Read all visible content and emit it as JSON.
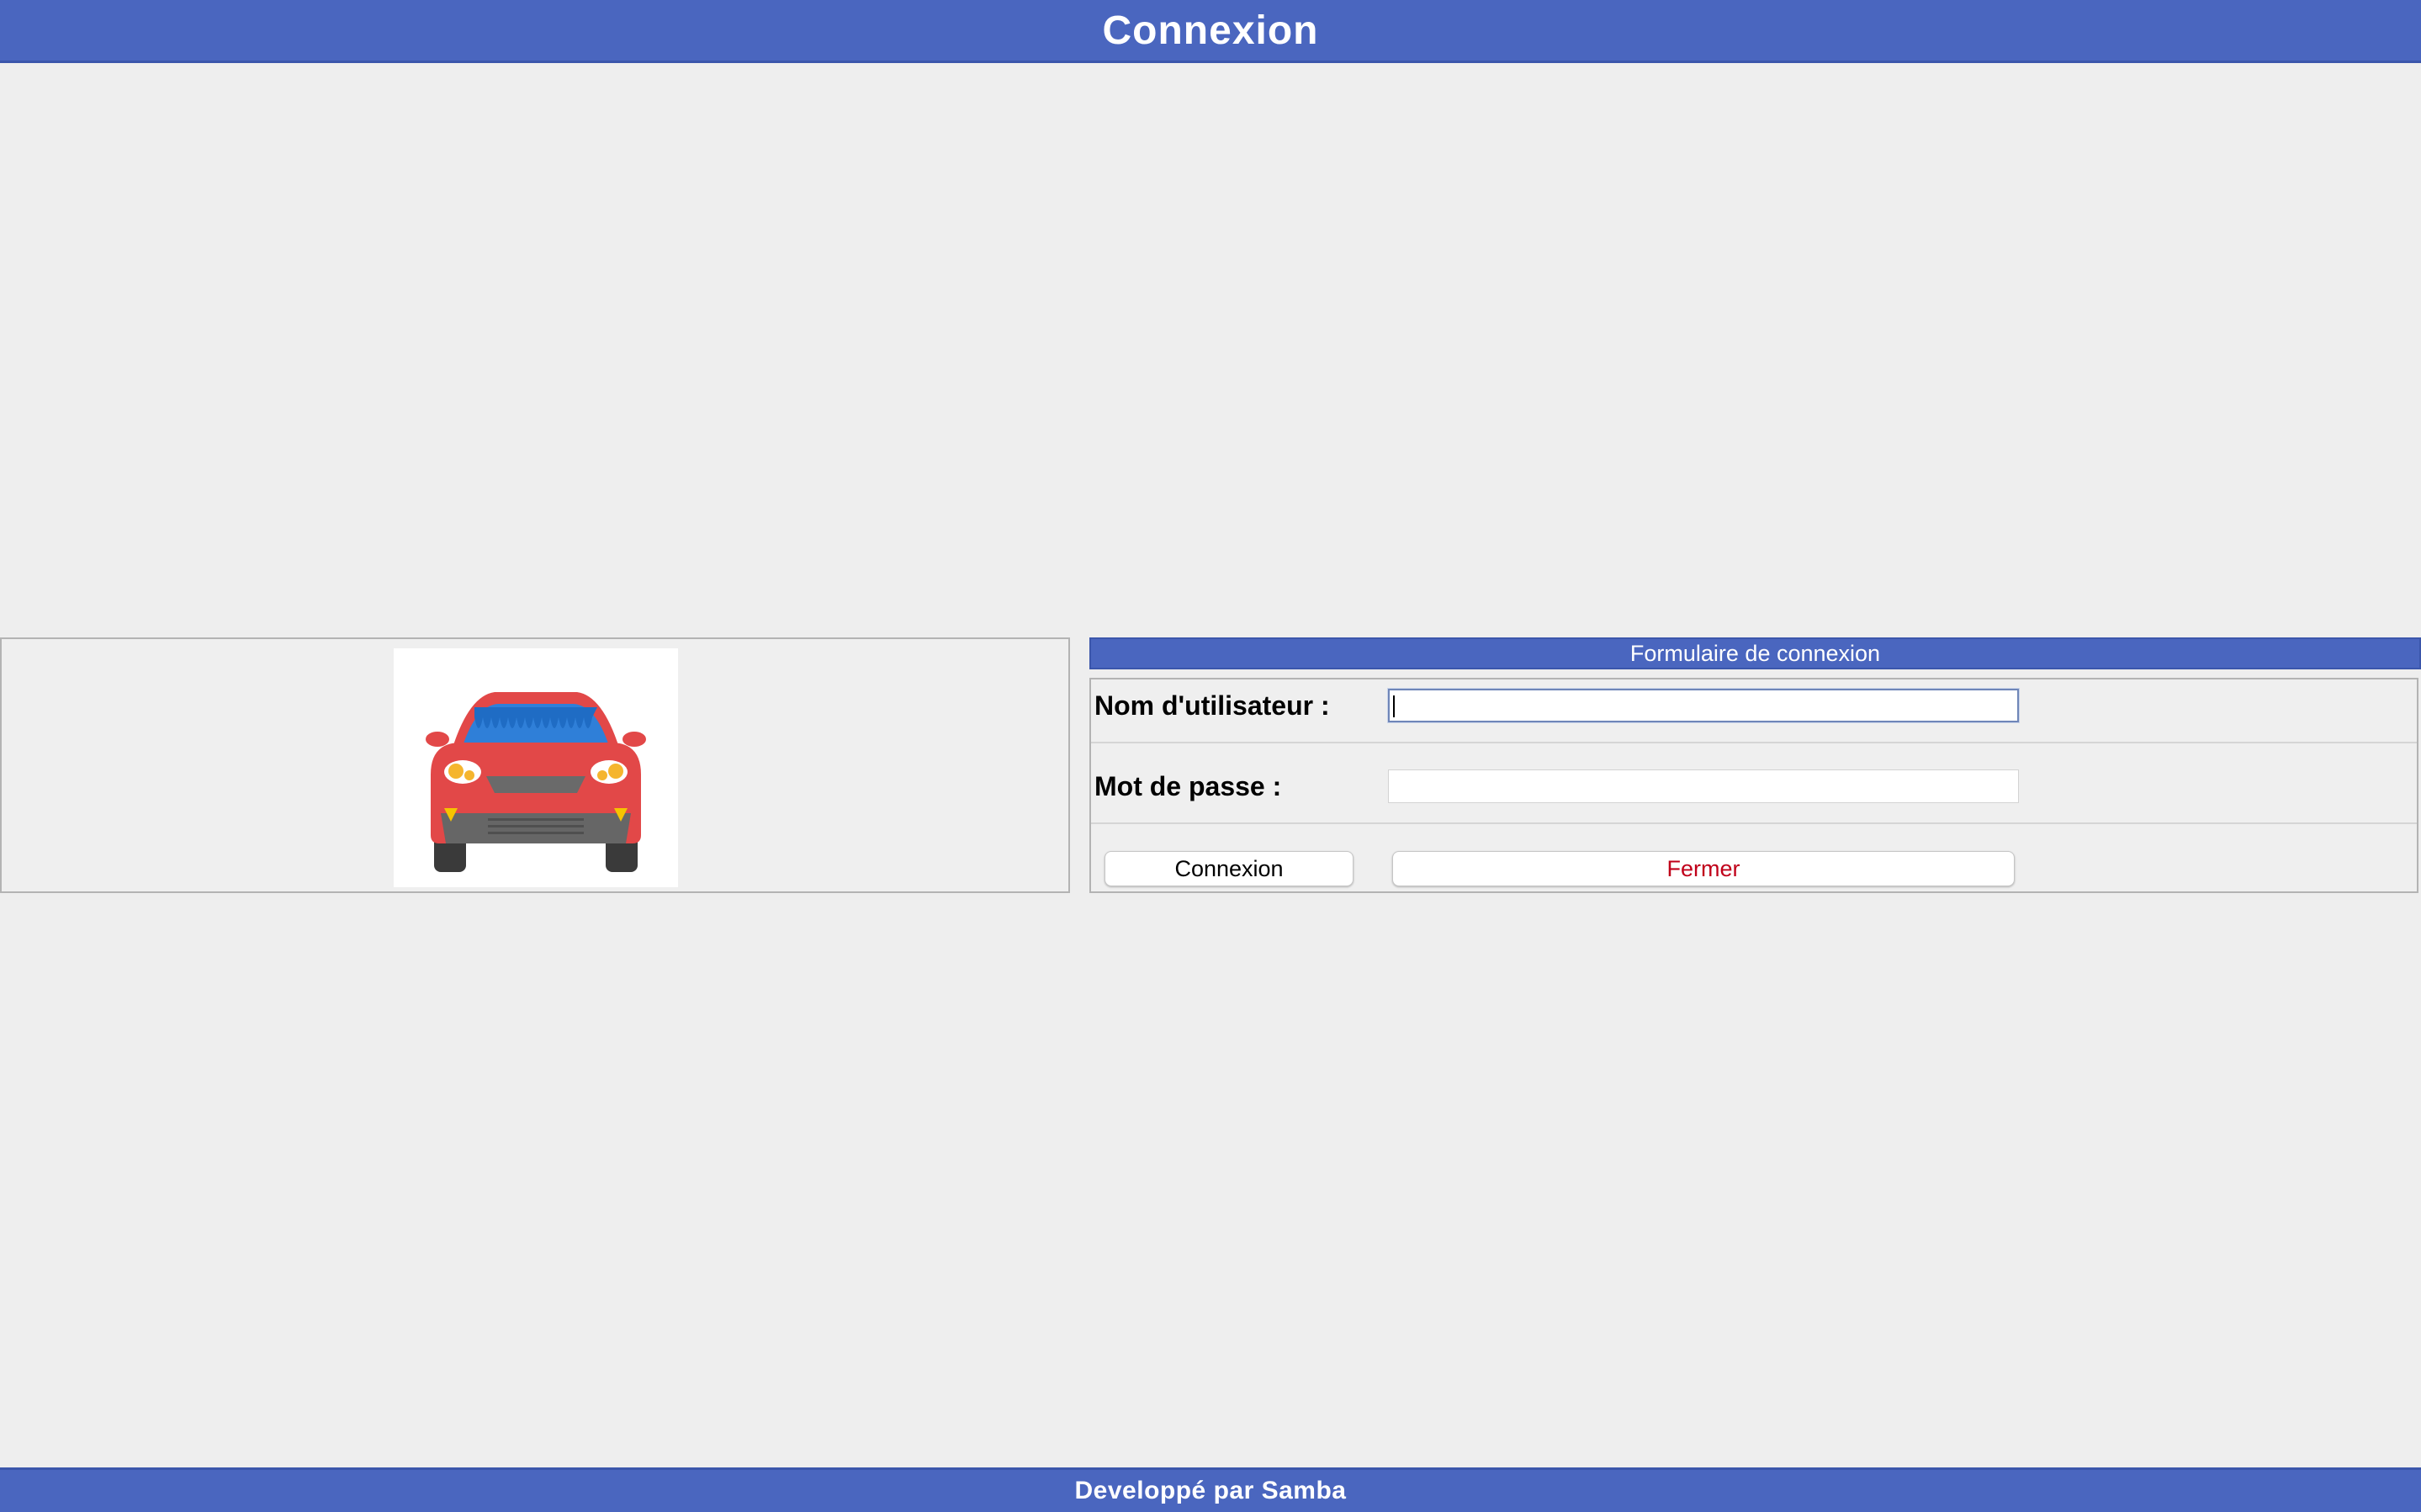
{
  "header": {
    "title": "Connexion"
  },
  "image_panel": {
    "icon": "car-front-icon"
  },
  "form": {
    "title": "Formulaire de connexion",
    "username_label": "Nom d'utilisateur :",
    "username_value": "",
    "password_label": "Mot de passe :",
    "password_value": "",
    "login_button": "Connexion",
    "close_button": "Fermer"
  },
  "footer": {
    "text": "Developpé par Samba"
  },
  "colors": {
    "bar": "#4a66bf",
    "background": "#eeeeee",
    "close_text": "#c0001a"
  }
}
